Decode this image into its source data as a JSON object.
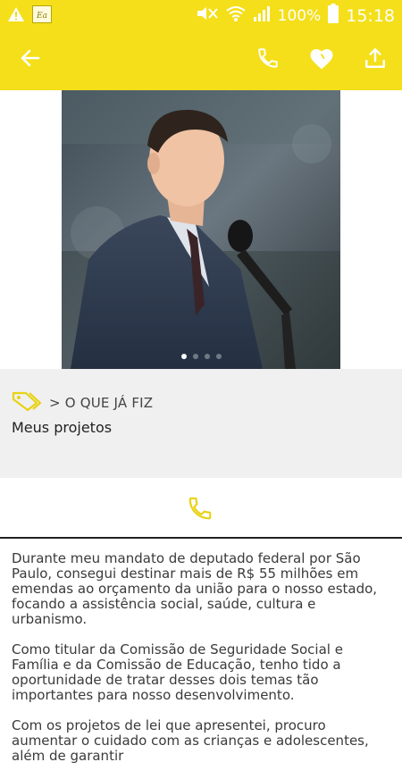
{
  "status_bar": {
    "battery": "100%",
    "time": "15:18",
    "notification_icons": [
      "warning-icon",
      "app-notification-icon"
    ],
    "system_icons": [
      "mute-icon",
      "wifi-icon",
      "signal-icon",
      "battery-icon"
    ]
  },
  "app_bar": {
    "actions": [
      "back-arrow-icon",
      "phone-icon",
      "heart-icon",
      "share-icon"
    ],
    "color": "#f4df1a"
  },
  "carousel": {
    "image": "photo-politician-speaking",
    "slide_count": 4,
    "active_index": 0
  },
  "info": {
    "breadcrumb": "> O QUE JÁ FIZ",
    "subtitle": "Meus projetos"
  },
  "description": {
    "paragraphs": [
      "Durante meu mandato de deputado federal por São Paulo, consegui destinar mais de R$ 55 milhões em emendas ao orçamento da união para o nosso estado, focando a assistência social, saúde, cultura e urbanismo.",
      "Como titular da Comissão de Seguridade Social e Família e da Comissão de Educação, tenho tido a oportunidade de tratar desses dois temas tão importantes para nosso desenvolvimento.",
      "Com os projetos de lei que apresentei, procuro aumentar o cuidado com as crianças e adolescentes, além de garantir"
    ]
  },
  "colors": {
    "accent": "#f4df1a",
    "panel": "#f0f0f0",
    "text": "#3a3a3a"
  }
}
